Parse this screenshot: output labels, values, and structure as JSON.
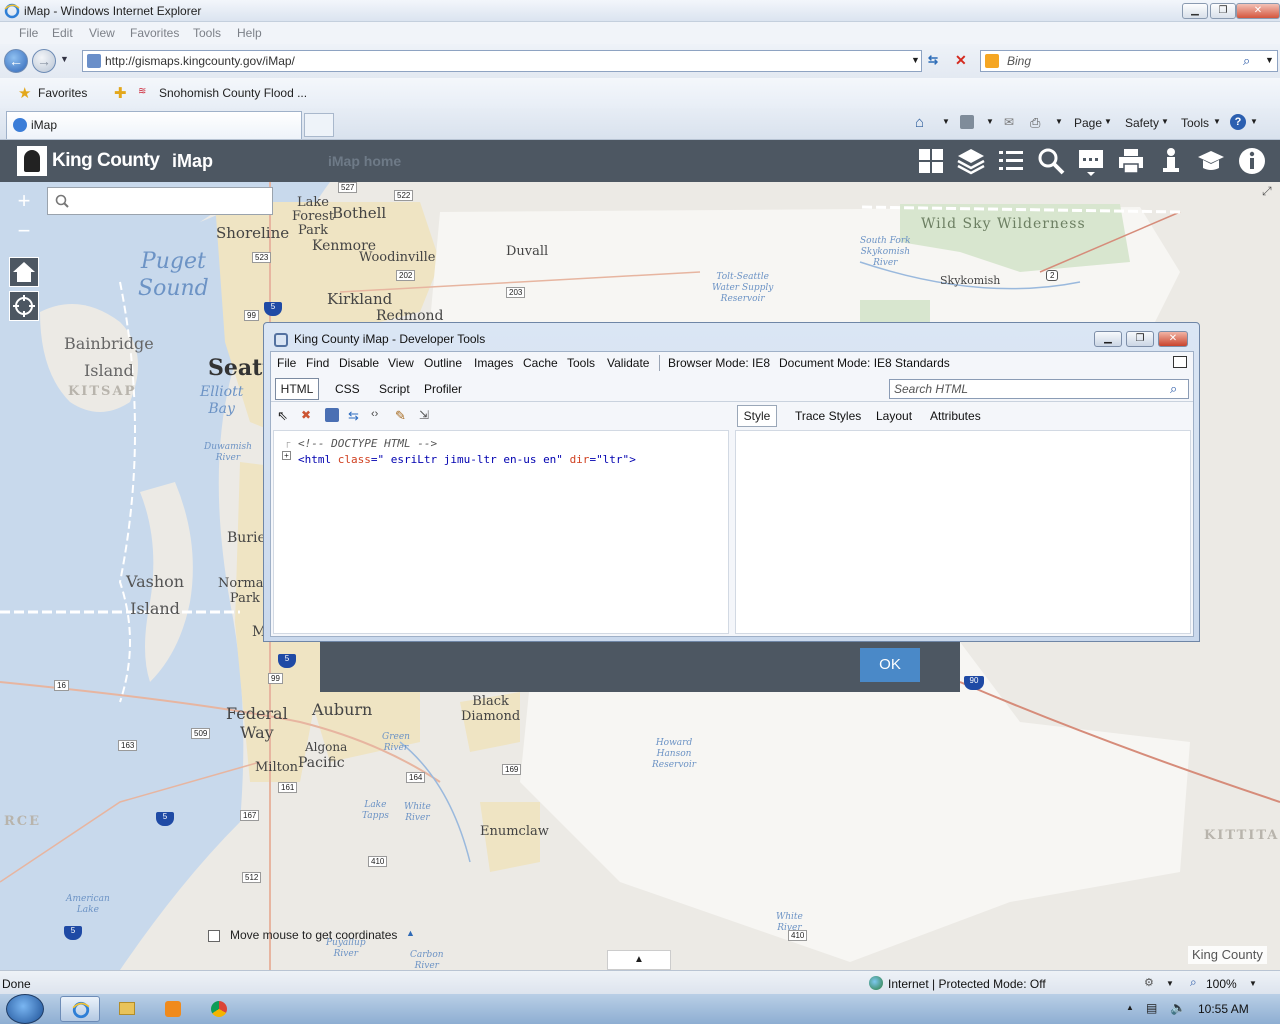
{
  "window": {
    "title": "iMap - Windows Internet Explorer"
  },
  "menubar": {
    "items": [
      "File",
      "Edit",
      "View",
      "Favorites",
      "Tools",
      "Help"
    ]
  },
  "address": {
    "url": "http://gismaps.kingcounty.gov/iMap/",
    "search_placeholder": "Bing"
  },
  "favorites": {
    "favorites_label": "Favorites",
    "link_label": "Snohomish County Flood ..."
  },
  "tabs": {
    "active_label": "iMap",
    "commands": [
      "Page",
      "Safety",
      "Tools"
    ]
  },
  "app": {
    "brand": "King County",
    "app_name": "iMap",
    "home_link": "iMap home",
    "tool_icons": [
      "grid-icon",
      "layers-icon",
      "list-icon",
      "search-icon",
      "map-tools-icon",
      "print-icon",
      "person-icon",
      "graduation-cap-icon",
      "info-icon"
    ]
  },
  "map": {
    "zoom_in": "+",
    "zoom_out": "−",
    "coordinates_text": "Move mouse to get coordinates",
    "attribution": "King County",
    "places": {
      "lake_forest_park": [
        "Lake",
        "Forest",
        "Park"
      ],
      "bothell": "Bothell",
      "shoreline": "Shoreline",
      "kenmore": "Kenmore",
      "woodinville": "Woodinville",
      "duvall": "Duvall",
      "kirkland": "Kirkland",
      "redmond": "Redmond",
      "seattle": "Seatt",
      "bainbridge": [
        "Bainbridge",
        "Island"
      ],
      "vashon": [
        "Vashon",
        "Island"
      ],
      "burien": "Burie",
      "normandy_park": [
        "Norman",
        "Park"
      ],
      "federal_way": [
        "Federal",
        "Way"
      ],
      "auburn": "Auburn",
      "algona": "Algona",
      "pacific": "Pacific",
      "milton": "Milton",
      "black_diamond": [
        "Black",
        "Diamond"
      ],
      "enumclaw": "Enumclaw",
      "skykomish": "Skykomish",
      "wild_sky": "Wild Sky Wilderness",
      "m_partial": "M"
    },
    "water": {
      "puget_sound": [
        "Puget",
        "Sound"
      ],
      "elliott_bay": [
        "Elliott",
        "Bay"
      ],
      "duwamish": [
        "Duwamish",
        "River"
      ],
      "south_fork": [
        "South Fork",
        "Skykomish",
        "River"
      ],
      "tolt": [
        "Tolt-Seattle",
        "Water Supply",
        "Reservoir"
      ],
      "green_river": [
        "Green",
        "River"
      ],
      "howard_hanson": [
        "Howard",
        "Hanson",
        "Reservoir"
      ],
      "lake_tapps": [
        "Lake",
        "Tapps"
      ],
      "white_river": [
        "White",
        "River"
      ],
      "white_river_2": [
        "White",
        "River"
      ],
      "american_lake": [
        "American",
        "Lake"
      ],
      "puyallup": [
        "Puyallup",
        "River"
      ],
      "carbon": [
        "Carbon",
        "River"
      ]
    },
    "counties": {
      "kitsap": "KITSAP",
      "pierce": "RCE",
      "kittitas": "KITTITA"
    },
    "shields": [
      "527",
      "522",
      "523",
      "202",
      "203",
      "2",
      "5",
      "99",
      "5",
      "99",
      "509",
      "16",
      "163",
      "161",
      "167",
      "5",
      "512",
      "5",
      "164",
      "169",
      "410",
      "410",
      "90"
    ]
  },
  "dialog": {
    "ok_label": "OK"
  },
  "devtools": {
    "title": "King County iMap - Developer Tools",
    "menu": [
      "File",
      "Find",
      "Disable",
      "View",
      "Outline",
      "Images",
      "Cache",
      "Tools",
      "Validate"
    ],
    "browser_mode": "Browser Mode: IE8",
    "document_mode": "Document Mode: IE8 Standards",
    "tabs": [
      "HTML",
      "CSS",
      "Script",
      "Profiler"
    ],
    "search_placeholder": "Search HTML",
    "right_tabs": [
      "Style",
      "Trace Styles",
      "Layout",
      "Attributes"
    ],
    "tree": {
      "comment": "<!-- DOCTYPE HTML -->",
      "tag_open": "<html",
      "attr_class": "class",
      "eq1": "=",
      "val_class": "\" esriLtr jimu-ltr en-us en\"",
      "attr_dir": "dir",
      "eq2": "=",
      "val_dir": "\"ltr\"",
      "tag_close": ">"
    }
  },
  "statusbar": {
    "left": "Done",
    "zone": "Internet | Protected Mode: Off",
    "zoom": "100%"
  },
  "taskbar": {
    "clock": "10:55 AM"
  }
}
